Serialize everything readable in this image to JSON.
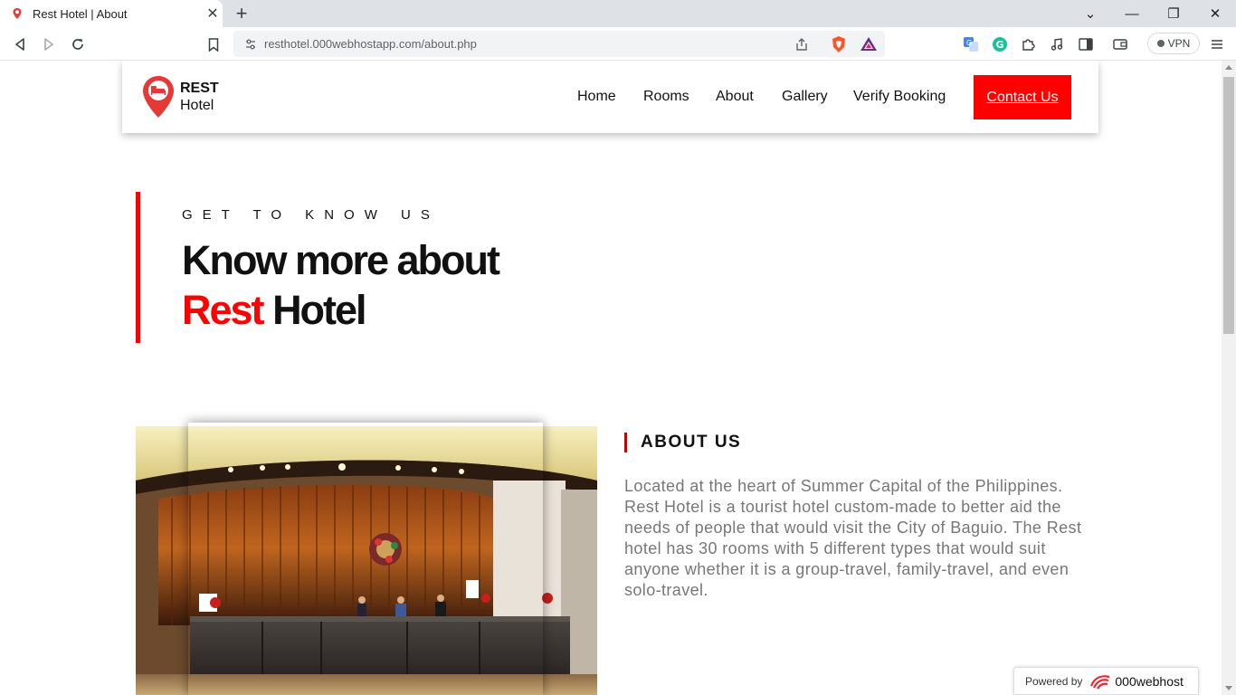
{
  "browser": {
    "tab_title": "Rest Hotel | About",
    "url": "resthotel.000webhostapp.com/about.php",
    "vpn_label": "VPN"
  },
  "header": {
    "logo_brand": "REST",
    "logo_sub": "Hotel",
    "menu": [
      {
        "label": "Home"
      },
      {
        "label": "Rooms"
      },
      {
        "label": "About"
      },
      {
        "label": "Gallery"
      },
      {
        "label": "Verify Booking"
      }
    ],
    "cta": "Contact Us"
  },
  "hero": {
    "eyebrow": "GET TO KNOW US",
    "title_line1": "Know more about",
    "title_accent": "Rest",
    "title_rest": "Hotel"
  },
  "about": {
    "title": "ABOUT US",
    "body": "Located at the heart of Summer Capital of the Philippines. Rest Hotel is a tourist hotel custom-made to better aid the needs of people that would visit the City of Baguio. The Rest hotel has 30 rooms with 5 different types that would suit anyone whether it is a group-travel, family-travel, and even solo-travel."
  },
  "footer_badge": {
    "label": "Powered by",
    "brand": "000webhost"
  },
  "colors": {
    "accent": "#ff0000",
    "text": "#111111",
    "muted": "#777777"
  }
}
